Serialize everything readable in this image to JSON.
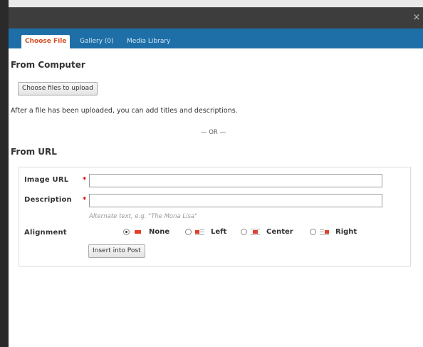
{
  "window": {
    "close_glyph": "×"
  },
  "tabs": [
    {
      "label": "Choose File",
      "active": true
    },
    {
      "label": "Gallery (0)",
      "active": false
    },
    {
      "label": "Media Library",
      "active": false
    }
  ],
  "from_computer": {
    "heading": "From Computer",
    "choose_button": "Choose files to upload",
    "note": "After a file has been uploaded, you can add titles and descriptions.",
    "or_text": "— OR —"
  },
  "from_url": {
    "heading": "From URL",
    "image_url_label": "Image URL",
    "image_url_value": "",
    "description_label": "Description",
    "description_value": "",
    "required_marker": "*",
    "hint": "Alternate text, e.g. \"The Mona Lisa\"",
    "alignment_label": "Alignment",
    "alignment_options": [
      {
        "label": "None",
        "icon": "align-none-icon",
        "checked": true
      },
      {
        "label": "Left",
        "icon": "align-left-icon",
        "checked": false
      },
      {
        "label": "Center",
        "icon": "align-center-icon",
        "checked": false
      },
      {
        "label": "Right",
        "icon": "align-right-icon",
        "checked": false
      }
    ],
    "insert_button": "Insert into Post"
  },
  "colors": {
    "tabbar": "#1e6fa8",
    "active_tab_text": "#d54e21",
    "required": "#dd0000"
  }
}
